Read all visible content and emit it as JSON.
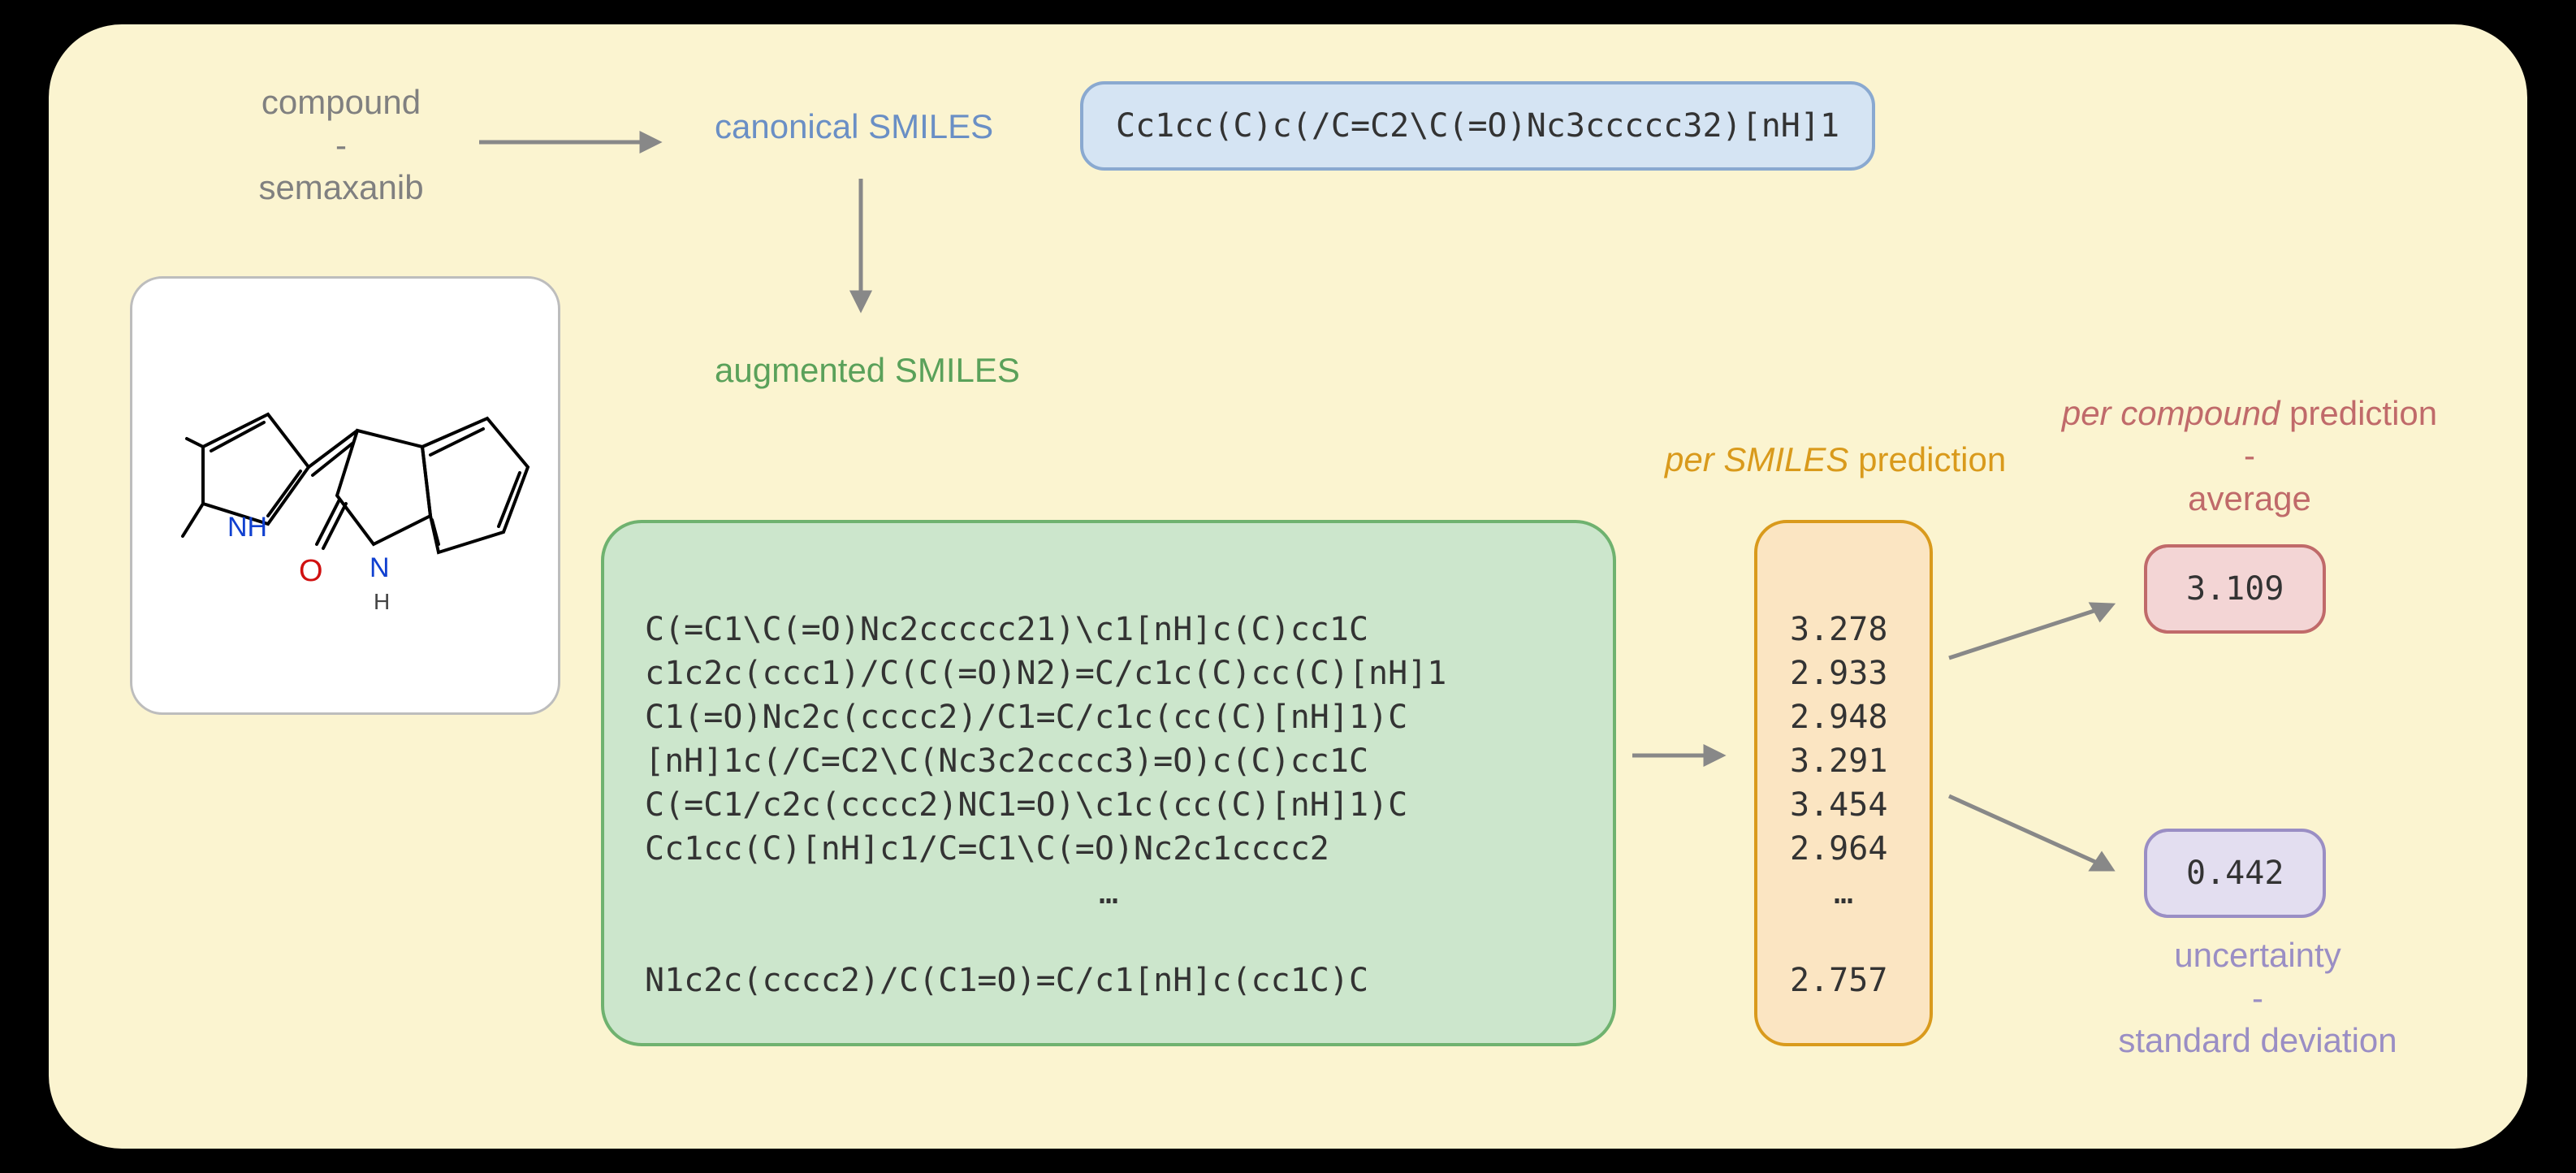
{
  "compound_label": "compound\n-\nsemaxanib",
  "canonical_label": "canonical SMILES",
  "canonical_smiles": "Cc1cc(C)c(/C=C2\\C(=O)Nc3ccccc32)[nH]1",
  "augmented_label": "augmented SMILES",
  "augmented_smiles": [
    "C(=C1\\C(=O)Nc2ccccc21)\\c1[nH]c(C)cc1C",
    "c1c2c(ccc1)/C(C(=O)N2)=C/c1c(C)cc(C)[nH]1",
    "C1(=O)Nc2c(cccc2)/C1=C/c1c(cc(C)[nH]1)C",
    "[nH]1c(/C=C2\\C(Nc3c2cccc3)=O)c(C)cc1C",
    "C(=C1/c2c(cccc2)NC1=O)\\c1c(cc(C)[nH]1)C",
    "Cc1cc(C)[nH]c1/C=C1\\C(=O)Nc2c1cccc2"
  ],
  "aug_ellipsis": "…",
  "augmented_last": "N1c2c(cccc2)/C(C1=O)=C/c1[nH]c(cc1C)C",
  "per_smiles_label": "per SMILES prediction",
  "per_smiles_label_pre": "per SMILES",
  "per_smiles_label_post": " prediction",
  "per_smiles_values": [
    "3.278",
    "2.933",
    "2.948",
    "3.291",
    "3.454",
    "2.964"
  ],
  "per_smiles_ellipsis": "…",
  "per_smiles_last": "2.757",
  "per_compound_label_pre": "per compound",
  "per_compound_label_post": " prediction\n-\naverage",
  "average_value": "3.109",
  "uncertainty_value": "0.442",
  "uncertainty_label": "uncertainty\n-\nstandard deviation",
  "molecule_atoms": {
    "N": "N",
    "O": "O",
    "H": "H",
    "NH": "NH"
  }
}
